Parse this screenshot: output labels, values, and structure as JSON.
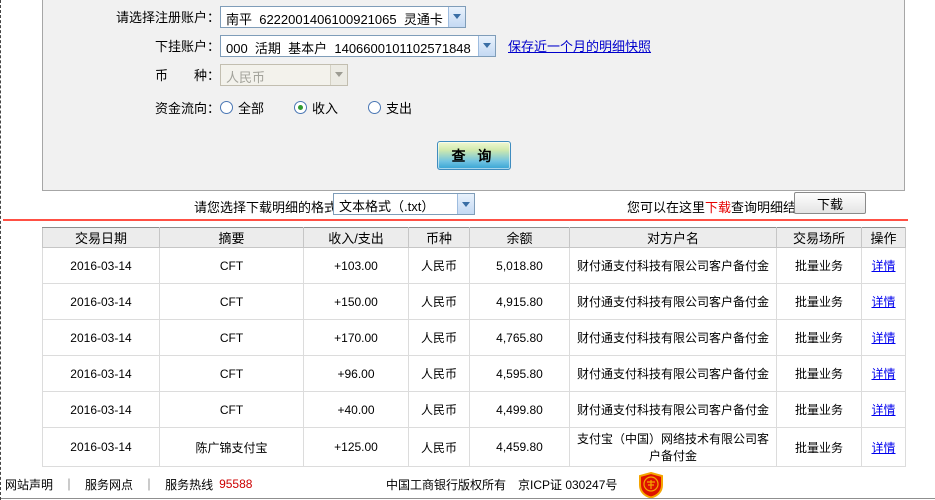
{
  "form": {
    "register_label": "请选择注册账户：",
    "register_value": "南平  6222001406100921065  灵通卡",
    "sub_label": "下挂账户：",
    "sub_value": "000  活期  基本户  1406600101102571848",
    "snapshot_link": "保存近一个月的明细快照",
    "currency_label": "币　　种：",
    "currency_value": "人民币",
    "flow_label": "资金流向：",
    "flow_options": {
      "all": "全部",
      "income": "收入",
      "expense": "支出"
    },
    "query_button": "查 询"
  },
  "download": {
    "format_label": "请您选择下载明细的格式",
    "format_value": "文本格式（.txt）",
    "hint_prefix": "您可以在这里",
    "hint_link": "下载",
    "hint_suffix": "查询明细结果",
    "button": "下载"
  },
  "table": {
    "headers": [
      "交易日期",
      "摘要",
      "收入/支出",
      "币种",
      "余额",
      "对方户名",
      "交易场所",
      "操作"
    ],
    "rows": [
      {
        "date": "2016-03-14",
        "summary": "CFT",
        "amount": "+103.00",
        "currency": "人民币",
        "balance": "5,018.80",
        "counterparty": "财付通支付科技有限公司客户备付金",
        "venue": "批量业务",
        "action": "详情"
      },
      {
        "date": "2016-03-14",
        "summary": "CFT",
        "amount": "+150.00",
        "currency": "人民币",
        "balance": "4,915.80",
        "counterparty": "财付通支付科技有限公司客户备付金",
        "venue": "批量业务",
        "action": "详情"
      },
      {
        "date": "2016-03-14",
        "summary": "CFT",
        "amount": "+170.00",
        "currency": "人民币",
        "balance": "4,765.80",
        "counterparty": "财付通支付科技有限公司客户备付金",
        "venue": "批量业务",
        "action": "详情"
      },
      {
        "date": "2016-03-14",
        "summary": "CFT",
        "amount": "+96.00",
        "currency": "人民币",
        "balance": "4,595.80",
        "counterparty": "财付通支付科技有限公司客户备付金",
        "venue": "批量业务",
        "action": "详情"
      },
      {
        "date": "2016-03-14",
        "summary": "CFT",
        "amount": "+40.00",
        "currency": "人民币",
        "balance": "4,499.80",
        "counterparty": "财付通支付科技有限公司客户备付金",
        "venue": "批量业务",
        "action": "详情"
      },
      {
        "date": "2016-03-14",
        "summary": "陈广锦支付宝",
        "amount": "+125.00",
        "currency": "人民币",
        "balance": "4,459.80",
        "counterparty": "支付宝（中国）网络技术有限公司客户备付金",
        "venue": "批量业务",
        "action": "详情"
      }
    ]
  },
  "footer": {
    "link_statement": "网站声明",
    "link_branches": "服务网点",
    "separator": "｜",
    "hotline_label": "服务热线",
    "hotline_number": "95588",
    "copyright": "中国工商银行版权所有　京ICP证 030247号"
  },
  "colors": {
    "accent_red": "#ff0000",
    "link_blue": "#0000cc",
    "divider_red": "#ff5044",
    "panel_gray": "#f1f1f1"
  }
}
